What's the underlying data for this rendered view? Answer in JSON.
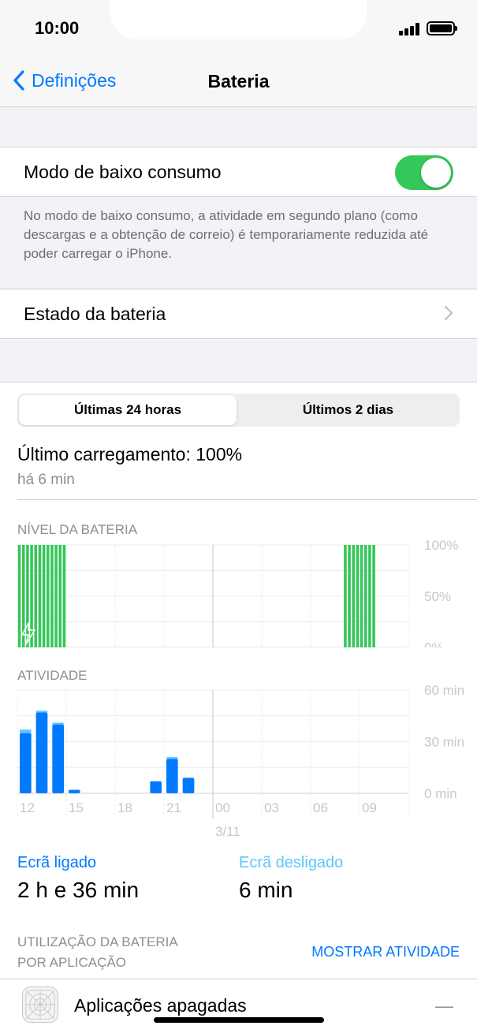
{
  "status_bar": {
    "time": "10:00"
  },
  "nav": {
    "back_label": "Definições",
    "title": "Bateria"
  },
  "low_power": {
    "label": "Modo de baixo consumo",
    "enabled": true,
    "footnote": "No modo de baixo consumo, a atividade em segundo plano (como descargas e a obtenção de correio) é temporariamente reduzida até poder carregar o iPhone."
  },
  "battery_health": {
    "label": "Estado da bateria"
  },
  "tabs": [
    {
      "label": "Últimas 24 horas",
      "selected": true
    },
    {
      "label": "Últimos 2 dias",
      "selected": false
    }
  ],
  "last_charge": {
    "label": "Último carregamento: 100%",
    "ago": "há 6 min"
  },
  "colors": {
    "accent": "#007aff",
    "green": "#34c759",
    "screen_off": "#5ac8fa"
  },
  "chart_data": [
    {
      "type": "bar",
      "title": "NÍVEL DA BATERIA",
      "y_ticks": [
        "100%",
        "50%",
        "0%"
      ],
      "ylim": [
        0,
        100
      ],
      "x": [
        0,
        0.25,
        0.5,
        0.75,
        1,
        1.25,
        1.5,
        1.75,
        2,
        2.25,
        2.5,
        2.75,
        20,
        20.25,
        20.5,
        20.75,
        21,
        21.25,
        21.5,
        21.75
      ],
      "values": [
        100,
        100,
        100,
        100,
        100,
        100,
        100,
        100,
        100,
        100,
        100,
        100,
        100,
        100,
        100,
        100,
        100,
        100,
        100,
        100
      ],
      "xlim": [
        0,
        24
      ],
      "charging_icon": "lightning-bolt-icon",
      "color": "#34c759"
    },
    {
      "type": "bar",
      "title": "ATIVIDADE",
      "y_ticks": [
        "60 min",
        "30 min",
        "0 min"
      ],
      "ylim": [
        0,
        60
      ],
      "x_ticks": [
        "12",
        "15",
        "18",
        "21",
        "00",
        "03",
        "06",
        "09"
      ],
      "x_sublabel": "3/11",
      "x": [
        12,
        13,
        14,
        15,
        20,
        21,
        22
      ],
      "screen_on": [
        35,
        47,
        40,
        2,
        7,
        20,
        9
      ],
      "screen_off": [
        2,
        1,
        1,
        0,
        0,
        1,
        0
      ],
      "color": "#007aff"
    }
  ],
  "screen_on": {
    "label": "Ecrã ligado",
    "value": "2 h e 36 min"
  },
  "screen_off": {
    "label": "Ecrã desligado",
    "value": "6 min"
  },
  "usage": {
    "label_line1": "UTILIZAÇÃO DA BATERIA",
    "label_line2": "POR APLICAÇÃO",
    "show_activity": "MOSTRAR ATIVIDADE",
    "apps": [
      {
        "name": "Aplicações apagadas",
        "value": "—",
        "icon": "deleted-apps-icon"
      }
    ]
  }
}
